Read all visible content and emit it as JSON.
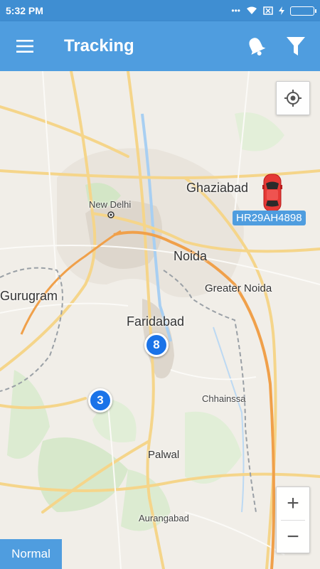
{
  "status_bar": {
    "time": "5:32 PM",
    "indicators": "•••"
  },
  "app_bar": {
    "title": "Tracking",
    "icons": [
      "menu-icon",
      "bell-icon",
      "filter-icon"
    ]
  },
  "map": {
    "labels": {
      "new_delhi": "New Delhi",
      "ghaziabad": "Ghaziabad",
      "noida": "Noida",
      "gurugram": "Gurugram",
      "greater_noida": "Greater Noida",
      "faridabad": "Faridabad",
      "chhainssa": "Chhainssa",
      "palwal": "Palwal",
      "aurangabad": "Aurangabad"
    },
    "clusters": [
      {
        "count": "8"
      },
      {
        "count": "3"
      }
    ],
    "vehicle": {
      "plate": "HR29AH4898",
      "color": "#e53935"
    },
    "controls": {
      "zoom_in": "+",
      "zoom_out": "−",
      "map_type": "Normal"
    }
  },
  "colors": {
    "accent": "#4f9ddf",
    "cluster": "#1a73e8"
  }
}
